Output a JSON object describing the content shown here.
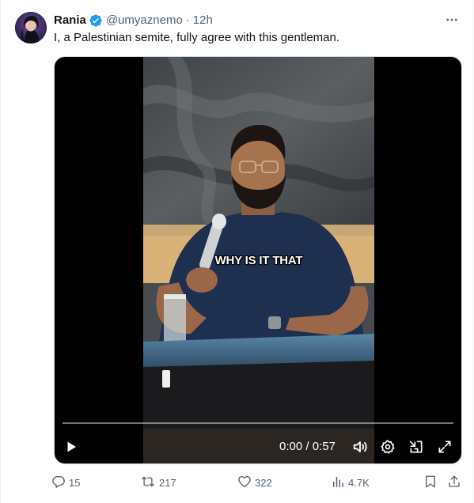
{
  "tweet": {
    "display_name": "Rania",
    "handle": "@umyaznemo",
    "separator": "·",
    "time": "12h",
    "text": "I, a Palestinian semite, fully agree with this gentleman.",
    "verified_color": "#1d9bf0"
  },
  "video": {
    "caption": "WHY IS IT THAT",
    "time_current": "0:00",
    "time_separator": " / ",
    "time_total": "0:57",
    "progress": 0.0,
    "controls": [
      "play-icon",
      "volume-icon",
      "settings-icon",
      "dock-icon",
      "fullscreen-icon"
    ]
  },
  "actions": {
    "replies": "15",
    "reposts": "217",
    "likes": "322",
    "views": "4.7K"
  },
  "colors": {
    "text_primary": "#0f1419",
    "text_secondary": "#536471",
    "accent": "#1d9bf0"
  }
}
